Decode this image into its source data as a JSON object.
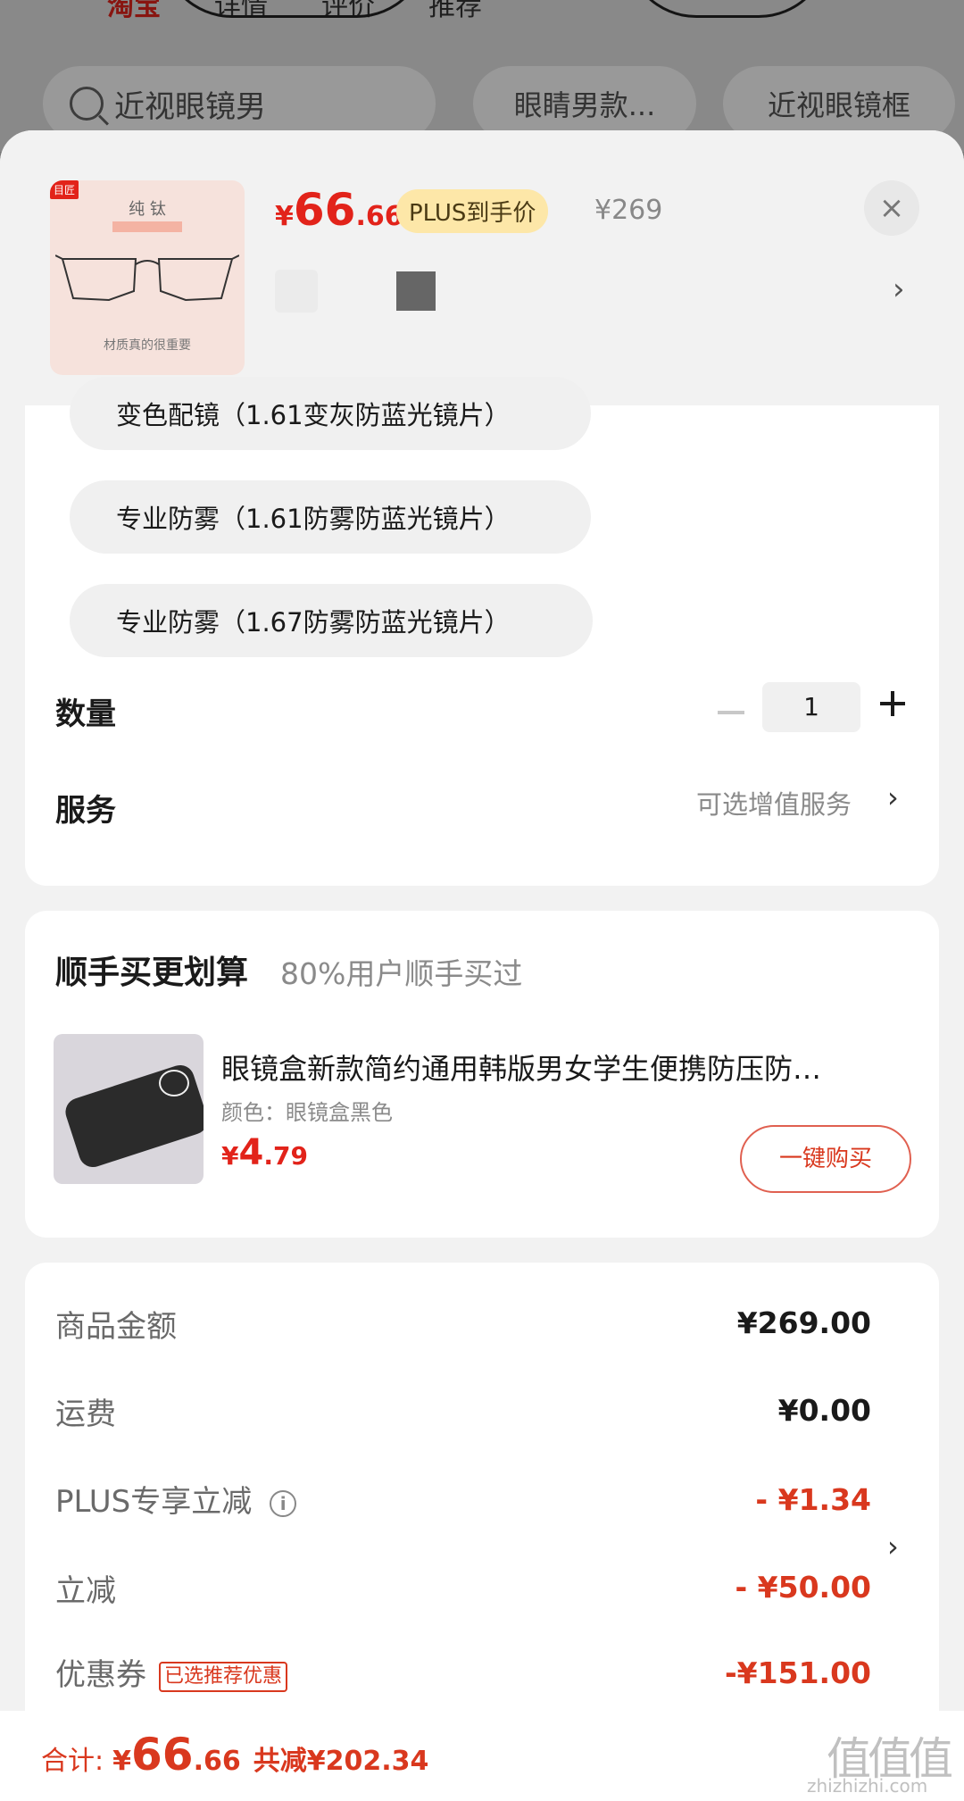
{
  "background": {
    "tabs": [
      "淘宝",
      "详情",
      "评价",
      "推荐"
    ],
    "search_text": "近视眼镜男",
    "chips": [
      "眼睛男款...",
      "近视眼镜框"
    ]
  },
  "product": {
    "thumb_tag": "目匠",
    "thumb_title": "纯 钛",
    "thumb_caption": "材质真的很重要",
    "price_currency": "¥",
    "price_int": "66",
    "price_dec": ".66",
    "plus_badge": "PLUS到手价",
    "original_price": "¥269",
    "close_icon": "×",
    "chevron": "›"
  },
  "options": [
    "变色配镜（1.61变灰防蓝光镜片）",
    "专业防雾（1.61防雾防蓝光镜片）",
    "专业防雾（1.67防雾防蓝光镜片）"
  ],
  "quantity": {
    "label": "数量",
    "value": "1"
  },
  "service": {
    "label": "服务",
    "value": "可选增值服务",
    "chevron": "›"
  },
  "bundle": {
    "title": "顺手买更划算",
    "subtitle": "80%用户顺手买过",
    "item_name": "眼镜盒新款简约通用韩版男女学生便携防压防…",
    "item_color": "颜色：眼镜盒黑色",
    "price_currency": "¥",
    "price_int": "4",
    "price_dec": ".79",
    "buy_label": "一键购买"
  },
  "summary": {
    "goods_label": "商品金额",
    "goods_value": "¥269.00",
    "shipping_label": "运费",
    "shipping_value": "¥0.00",
    "plus_label": "PLUS专享立减",
    "plus_value": "- ¥1.34",
    "discount_label": "立减",
    "discount_value": "- ¥50.00",
    "coupon_label": "优惠券",
    "coupon_tag": "已选推荐优惠",
    "coupon_value": "-¥151.00",
    "coupon_chevron": "›"
  },
  "footer": {
    "total_label": "合计:",
    "total_currency": "¥",
    "total_int": "66",
    "total_dec": ".66",
    "saved": "共减¥202.34",
    "watermark": "值值值",
    "watermark_url": "zhizhizhi.com"
  },
  "colors": {
    "accent": "#e2231a",
    "sheet_bg": "#f2f2f2",
    "plus_badge_bg": "#fde7a8"
  }
}
